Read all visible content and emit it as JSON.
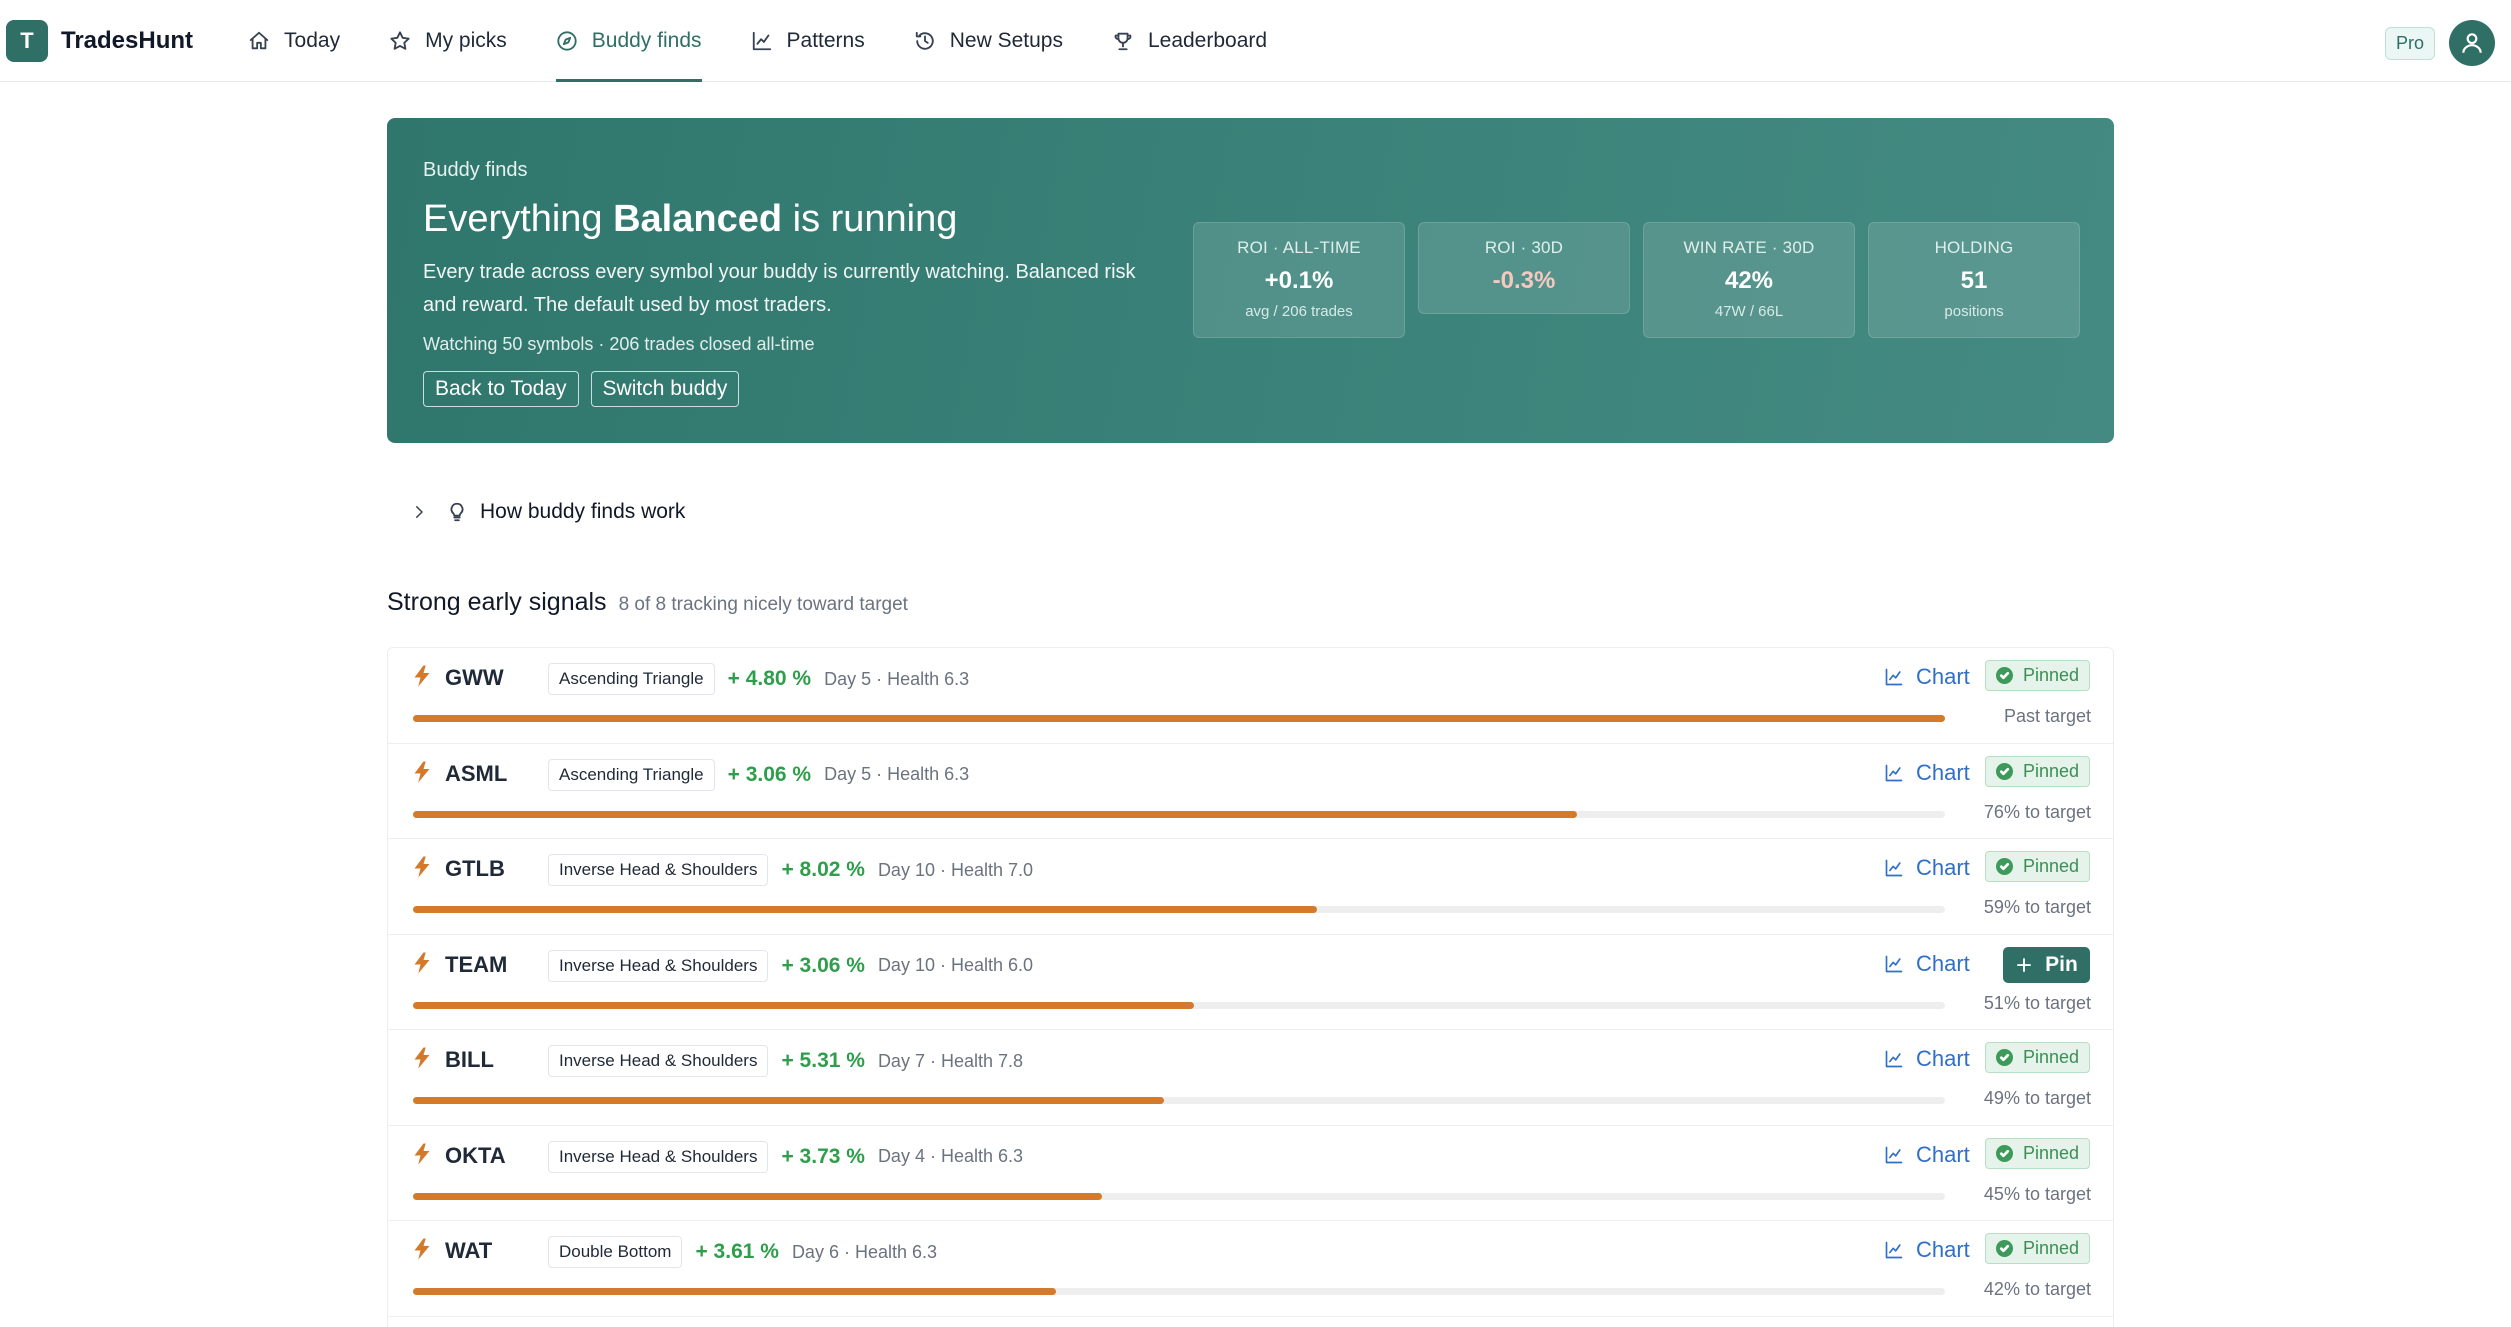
{
  "brand": {
    "logo_letter": "T",
    "name": "TradesHunt"
  },
  "nav": {
    "items": [
      {
        "label": "Today",
        "icon": "home-icon",
        "active": false
      },
      {
        "label": "My picks",
        "icon": "star-icon",
        "active": false
      },
      {
        "label": "Buddy finds",
        "icon": "compass-icon",
        "active": true
      },
      {
        "label": "Patterns",
        "icon": "line-chart-icon",
        "active": false
      },
      {
        "label": "New Setups",
        "icon": "history-icon",
        "active": false
      },
      {
        "label": "Leaderboard",
        "icon": "trophy-icon",
        "active": false
      }
    ],
    "badge": "Pro"
  },
  "hero": {
    "kicker": "Buddy finds",
    "title_prefix": "Everything ",
    "title_bold": "Balanced",
    "title_suffix": " is running",
    "description": "Every trade across every symbol your buddy is currently watching. Balanced risk and reward. The default used by most traders.",
    "meta": "Watching 50 symbols · 206 trades closed all-time",
    "buttons": {
      "back": "Back to Today",
      "switch": "Switch buddy"
    },
    "stats": [
      {
        "label": "ROI · ALL-TIME",
        "value": "+0.1%",
        "sub": "avg / 206 trades",
        "negative": false
      },
      {
        "label": "ROI · 30D",
        "value": "-0.3%",
        "sub": "",
        "negative": true
      },
      {
        "label": "WIN RATE · 30D",
        "value": "42%",
        "sub": "47W / 66L",
        "negative": false
      },
      {
        "label": "HOLDING",
        "value": "51",
        "sub": "positions",
        "negative": false
      }
    ]
  },
  "howto": {
    "label": "How buddy finds work"
  },
  "section": {
    "title": "Strong early signals",
    "subtitle": "8 of 8 tracking nicely toward target",
    "chart_label": "Chart",
    "pinned_label": "Pinned",
    "pin_label": "Pin",
    "rows": [
      {
        "ticker": "GWW",
        "pattern": "Ascending Triangle",
        "change": "+ 4.80 %",
        "meta": "Day 5 · Health 6.3",
        "progress": 1.0,
        "target": "Past target",
        "pinned": true
      },
      {
        "ticker": "ASML",
        "pattern": "Ascending Triangle",
        "change": "+ 3.06 %",
        "meta": "Day 5 · Health 6.3",
        "progress": 0.76,
        "target": "76% to target",
        "pinned": true
      },
      {
        "ticker": "GTLB",
        "pattern": "Inverse Head & Shoulders",
        "change": "+ 8.02 %",
        "meta": "Day 10 · Health 7.0",
        "progress": 0.59,
        "target": "59% to target",
        "pinned": true
      },
      {
        "ticker": "TEAM",
        "pattern": "Inverse Head & Shoulders",
        "change": "+ 3.06 %",
        "meta": "Day 10 · Health 6.0",
        "progress": 0.51,
        "target": "51% to target",
        "pinned": false
      },
      {
        "ticker": "BILL",
        "pattern": "Inverse Head & Shoulders",
        "change": "+ 5.31 %",
        "meta": "Day 7 · Health 7.8",
        "progress": 0.49,
        "target": "49% to target",
        "pinned": true
      },
      {
        "ticker": "OKTA",
        "pattern": "Inverse Head & Shoulders",
        "change": "+ 3.73 %",
        "meta": "Day 4 · Health 6.3",
        "progress": 0.45,
        "target": "45% to target",
        "pinned": true
      },
      {
        "ticker": "WAT",
        "pattern": "Double Bottom",
        "change": "+ 3.61 %",
        "meta": "Day 6 · Health 6.3",
        "progress": 0.42,
        "target": "42% to target",
        "pinned": true
      }
    ]
  },
  "colors": {
    "brand": "#2f6f66",
    "accent_orange": "#d47a2c",
    "positive": "#2f9e4b",
    "link": "#2f6fca"
  }
}
